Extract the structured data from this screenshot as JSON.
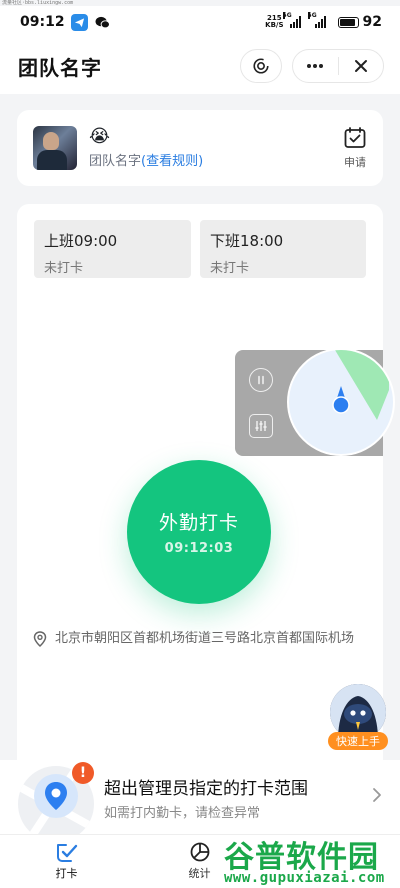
{
  "watermark_top": "流量社区·bbs.liuxingw.com",
  "status_bar": {
    "time": "09:12",
    "net_speed_value": "215",
    "net_speed_unit": "KB/S",
    "signal_1_tag": "5G",
    "signal_2_tag": "5G",
    "battery": "92",
    "battery_level": 0.92
  },
  "header": {
    "title": "团队名字"
  },
  "team": {
    "emoji": "😭",
    "name": "团队名字",
    "rules_link": "(查看规则)",
    "apply_label": "申请"
  },
  "shifts": [
    {
      "title": "上班09:00",
      "status": "未打卡"
    },
    {
      "title": "下班18:00",
      "status": "未打卡"
    }
  ],
  "punch": {
    "title": "外勤打卡",
    "time": "09:12:03"
  },
  "location": {
    "address": "北京市朝阳区首都机场街道三号路北京首都国际机场"
  },
  "helper": {
    "label": "快速上手"
  },
  "alert": {
    "badge": "!",
    "title": "超出管理员指定的打卡范围",
    "subtitle": "如需打内勤卡，请检查异常"
  },
  "tabs": [
    {
      "label": "打卡"
    },
    {
      "label": "统计"
    }
  ],
  "watermark": {
    "title": "谷普软件园",
    "url": "www.gupuxiazai.com"
  },
  "colors": {
    "primary_green": "#14c57f",
    "link_blue": "#2a7de1",
    "alert_orange": "#f05a28",
    "helper_orange": "#ff8f1f"
  }
}
